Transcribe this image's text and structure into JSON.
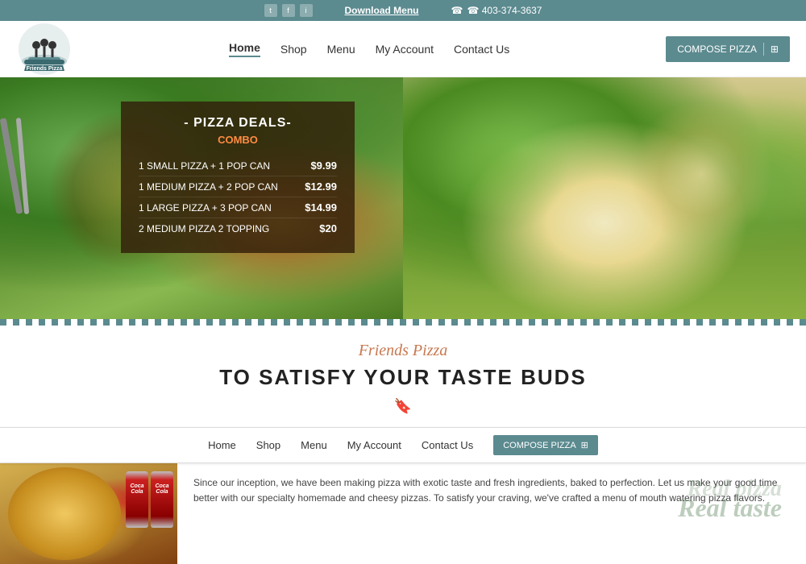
{
  "topbar": {
    "download_menu": "Download Menu",
    "phone": "☎ 403-374-3637",
    "social_icons": [
      "t",
      "f",
      "i"
    ]
  },
  "navbar": {
    "logo_text": "Friends Pizza",
    "links": [
      "Home",
      "Shop",
      "Menu",
      "My Account",
      "Contact Us"
    ],
    "active_link": "Home",
    "compose_label": "COMPOSE PIZZA"
  },
  "hero": {
    "deals_title": "- PIZZA DEALS-",
    "deals_subtitle": "COMBO",
    "deals": [
      {
        "name": "1 SMALL PIZZA + 1 POP CAN",
        "price": "$9.99"
      },
      {
        "name": "1 MEDIUM PIZZA + 2 POP CAN",
        "price": "$12.99"
      },
      {
        "name": "1 LARGE PIZZA + 3 POP CAN",
        "price": "$14.99"
      },
      {
        "name": "2 MEDIUM PIZZA 2 TOPPING",
        "price": "$20"
      }
    ]
  },
  "section": {
    "brand_script": "Friends Pizza",
    "tagline": "TO SATISFY YOUR TASTE BUDS"
  },
  "bottom_nav": {
    "links": [
      "Home",
      "Shop",
      "Menu",
      "My Account",
      "Contact Us"
    ],
    "compose_label": "COMPOSE PIZZA"
  },
  "bottom_content": {
    "watermark1": "Real pizza",
    "watermark2": "Real taste",
    "description": "Since our inception, we have been making pizza with exotic taste and fresh ingredients, baked to perfection. Let us make your good time better with our specialty homemade and cheesy pizzas. To satisfy your craving, we've crafted a menu of mouth watering pizza flavors."
  }
}
